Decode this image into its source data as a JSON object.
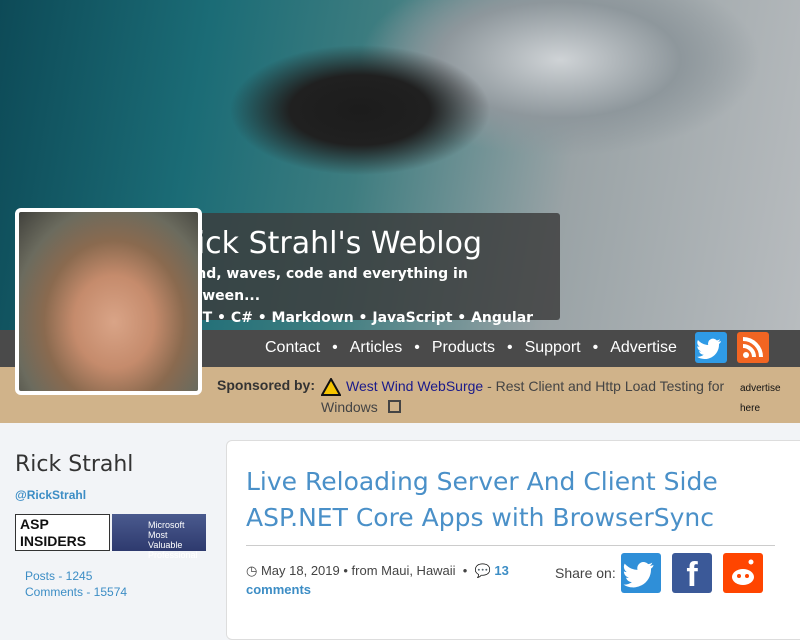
{
  "header": {
    "title": "Rick Strahl's Weblog",
    "tagline": "Wind, waves, code and everything in between...",
    "topics": ".NET • C# • Markdown • JavaScript • Angular"
  },
  "nav": {
    "items": [
      "Contact",
      "Articles",
      "Products",
      "Support",
      "Advertise"
    ],
    "separator": "•"
  },
  "sponsor": {
    "label": "Sponsored by:",
    "link": "West Wind WebSurge",
    "description": " - Rest Client and Http Load Testing for Windows",
    "advertise": "advertise here"
  },
  "sidebar": {
    "name": "Rick Strahl",
    "handle": "@RickStrahl",
    "badges": [
      "ASP INSIDERS",
      "Microsoft Most Valuable Professional"
    ],
    "posts": "Posts - 1245",
    "comments": "Comments - 15574"
  },
  "post": {
    "title": "Live Reloading Server And Client Side ASP.NET Core Apps with BrowserSync",
    "date": "May 18, 2019",
    "location": "• from Maui, Hawaii",
    "comments": "13 comments",
    "share_label": "Share on:"
  },
  "colors": {
    "twitter": "#1da1f2",
    "rss": "#f26522",
    "facebook": "#3b5998",
    "reddit": "#ff4500",
    "link": "#3c8dc5"
  }
}
